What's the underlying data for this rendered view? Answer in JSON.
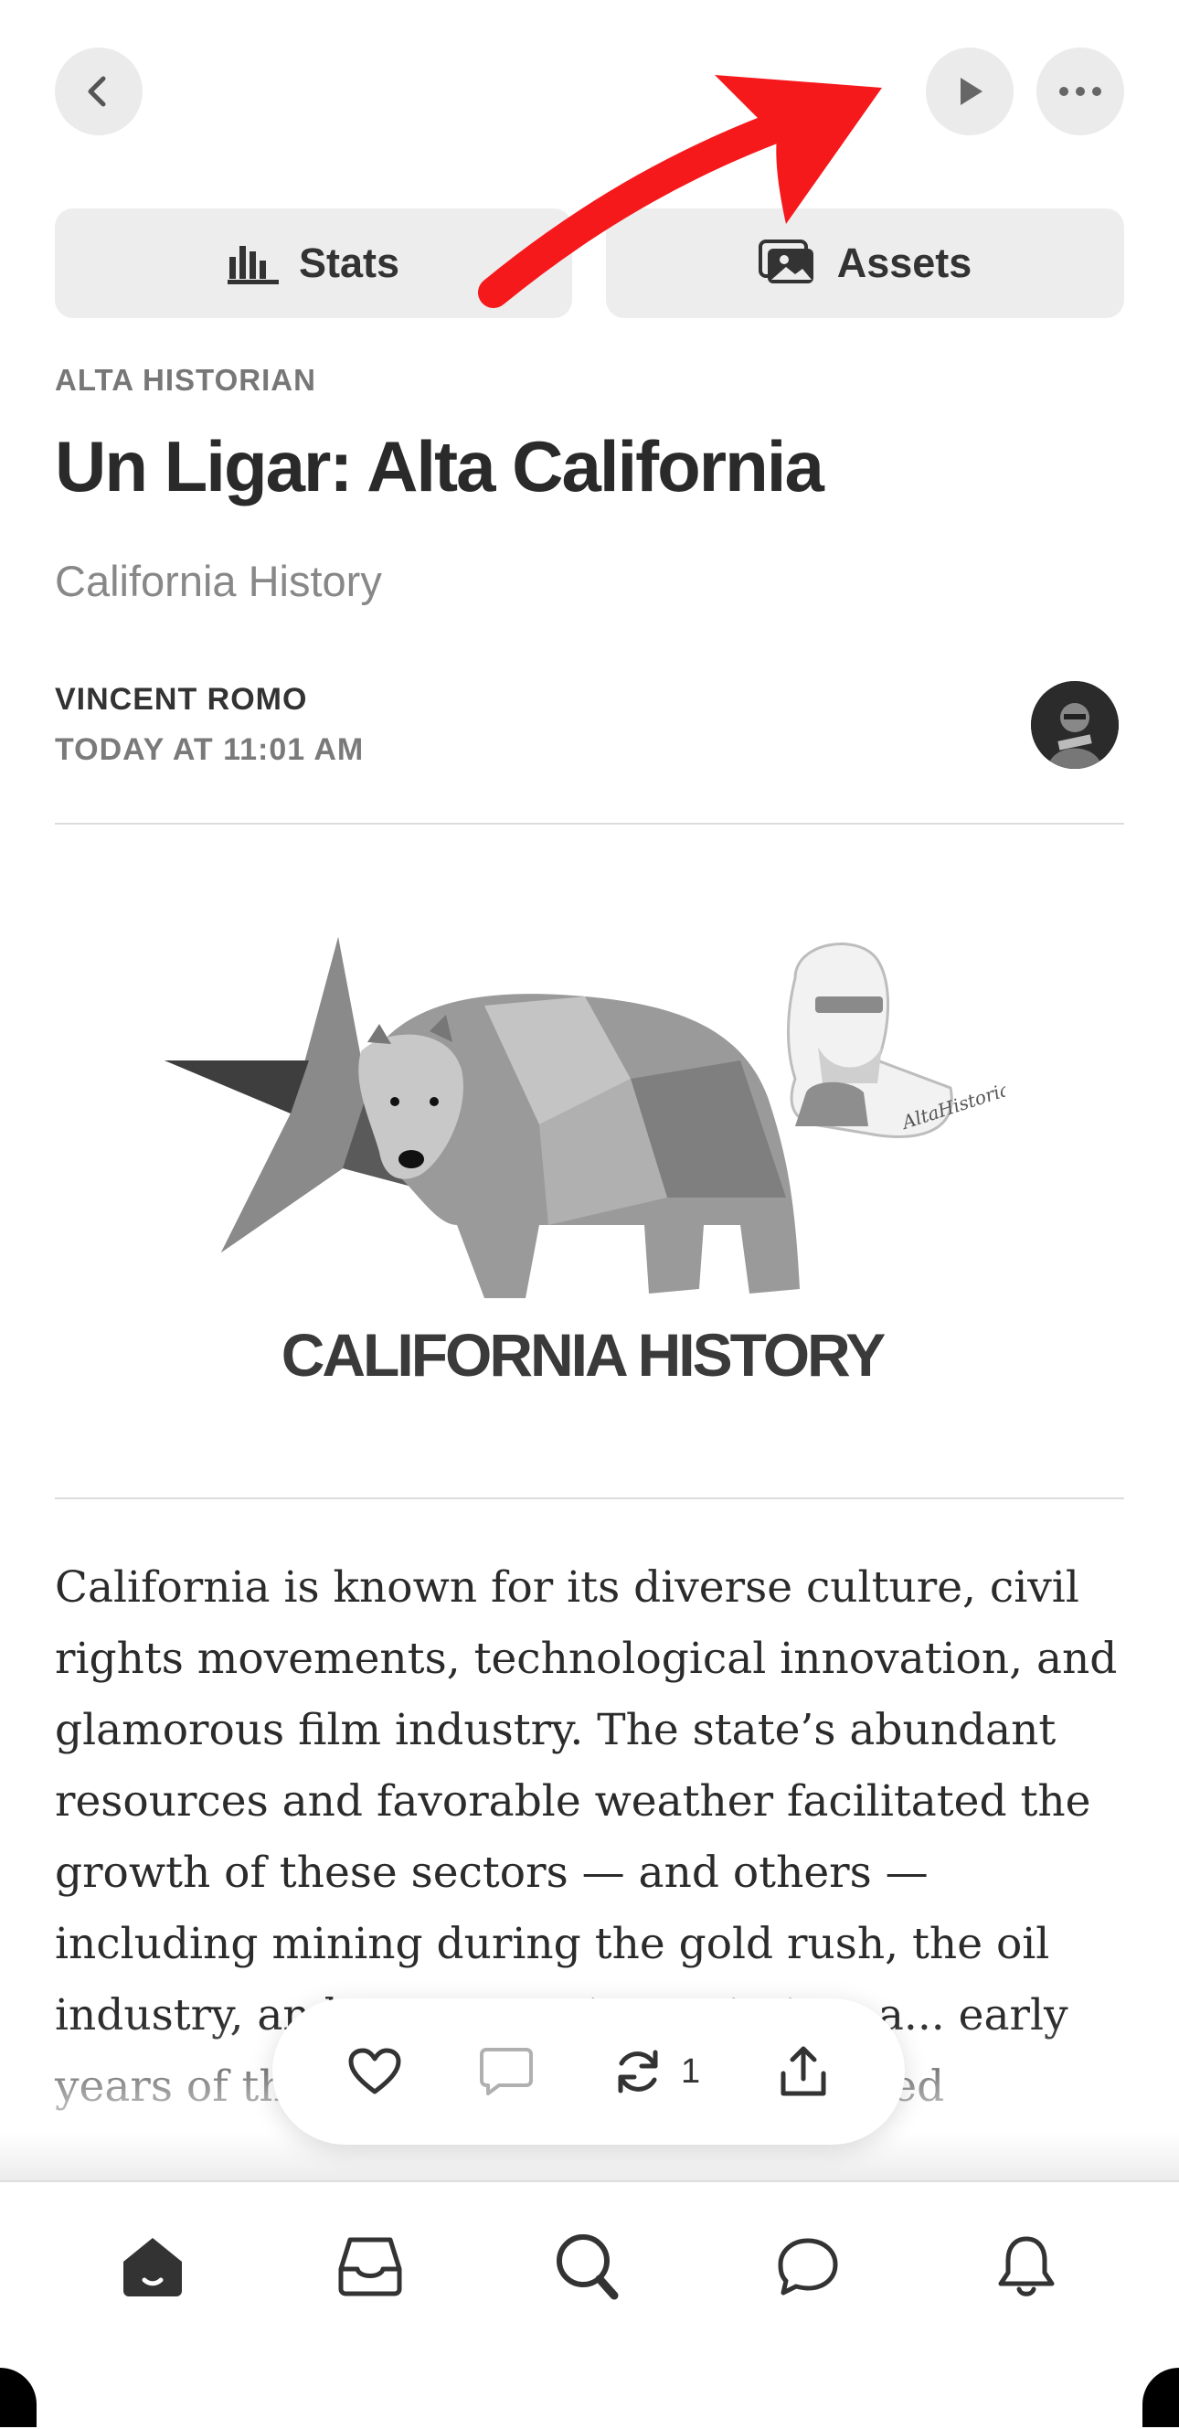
{
  "header": {
    "back_icon": "chevron-left-icon",
    "play_icon": "play-icon",
    "more_icon": "more-icon"
  },
  "segments": {
    "stats_label": "Stats",
    "assets_label": "Assets"
  },
  "post": {
    "publication": "ALTA HISTORIAN",
    "title": "Un Ligar: Alta California",
    "subtitle": "California History",
    "author": "VINCENT ROMO",
    "date": "TODAY AT 11:01 AM",
    "hero_caption": "CALIFORNIA HISTORY",
    "badge_text": "AltaHistorian",
    "body": "California is known for its diverse culture, civil rights movements, technological innovation, and glamorous film industry. The state’s abundant resources and favorable weather facilitated the growth of these sectors — and others — including mining during the gold rush, the oil industry, and ... automotive, aviation, a... early years of the state, cheap land and varied"
  },
  "actions": {
    "restack_count": "1"
  },
  "colors": {
    "annotation_arrow": "#f5191c",
    "button_bg": "#ebebeb"
  },
  "tabbar": {
    "items": [
      "home-icon",
      "inbox-icon",
      "search-icon",
      "chat-icon",
      "bell-icon"
    ]
  }
}
